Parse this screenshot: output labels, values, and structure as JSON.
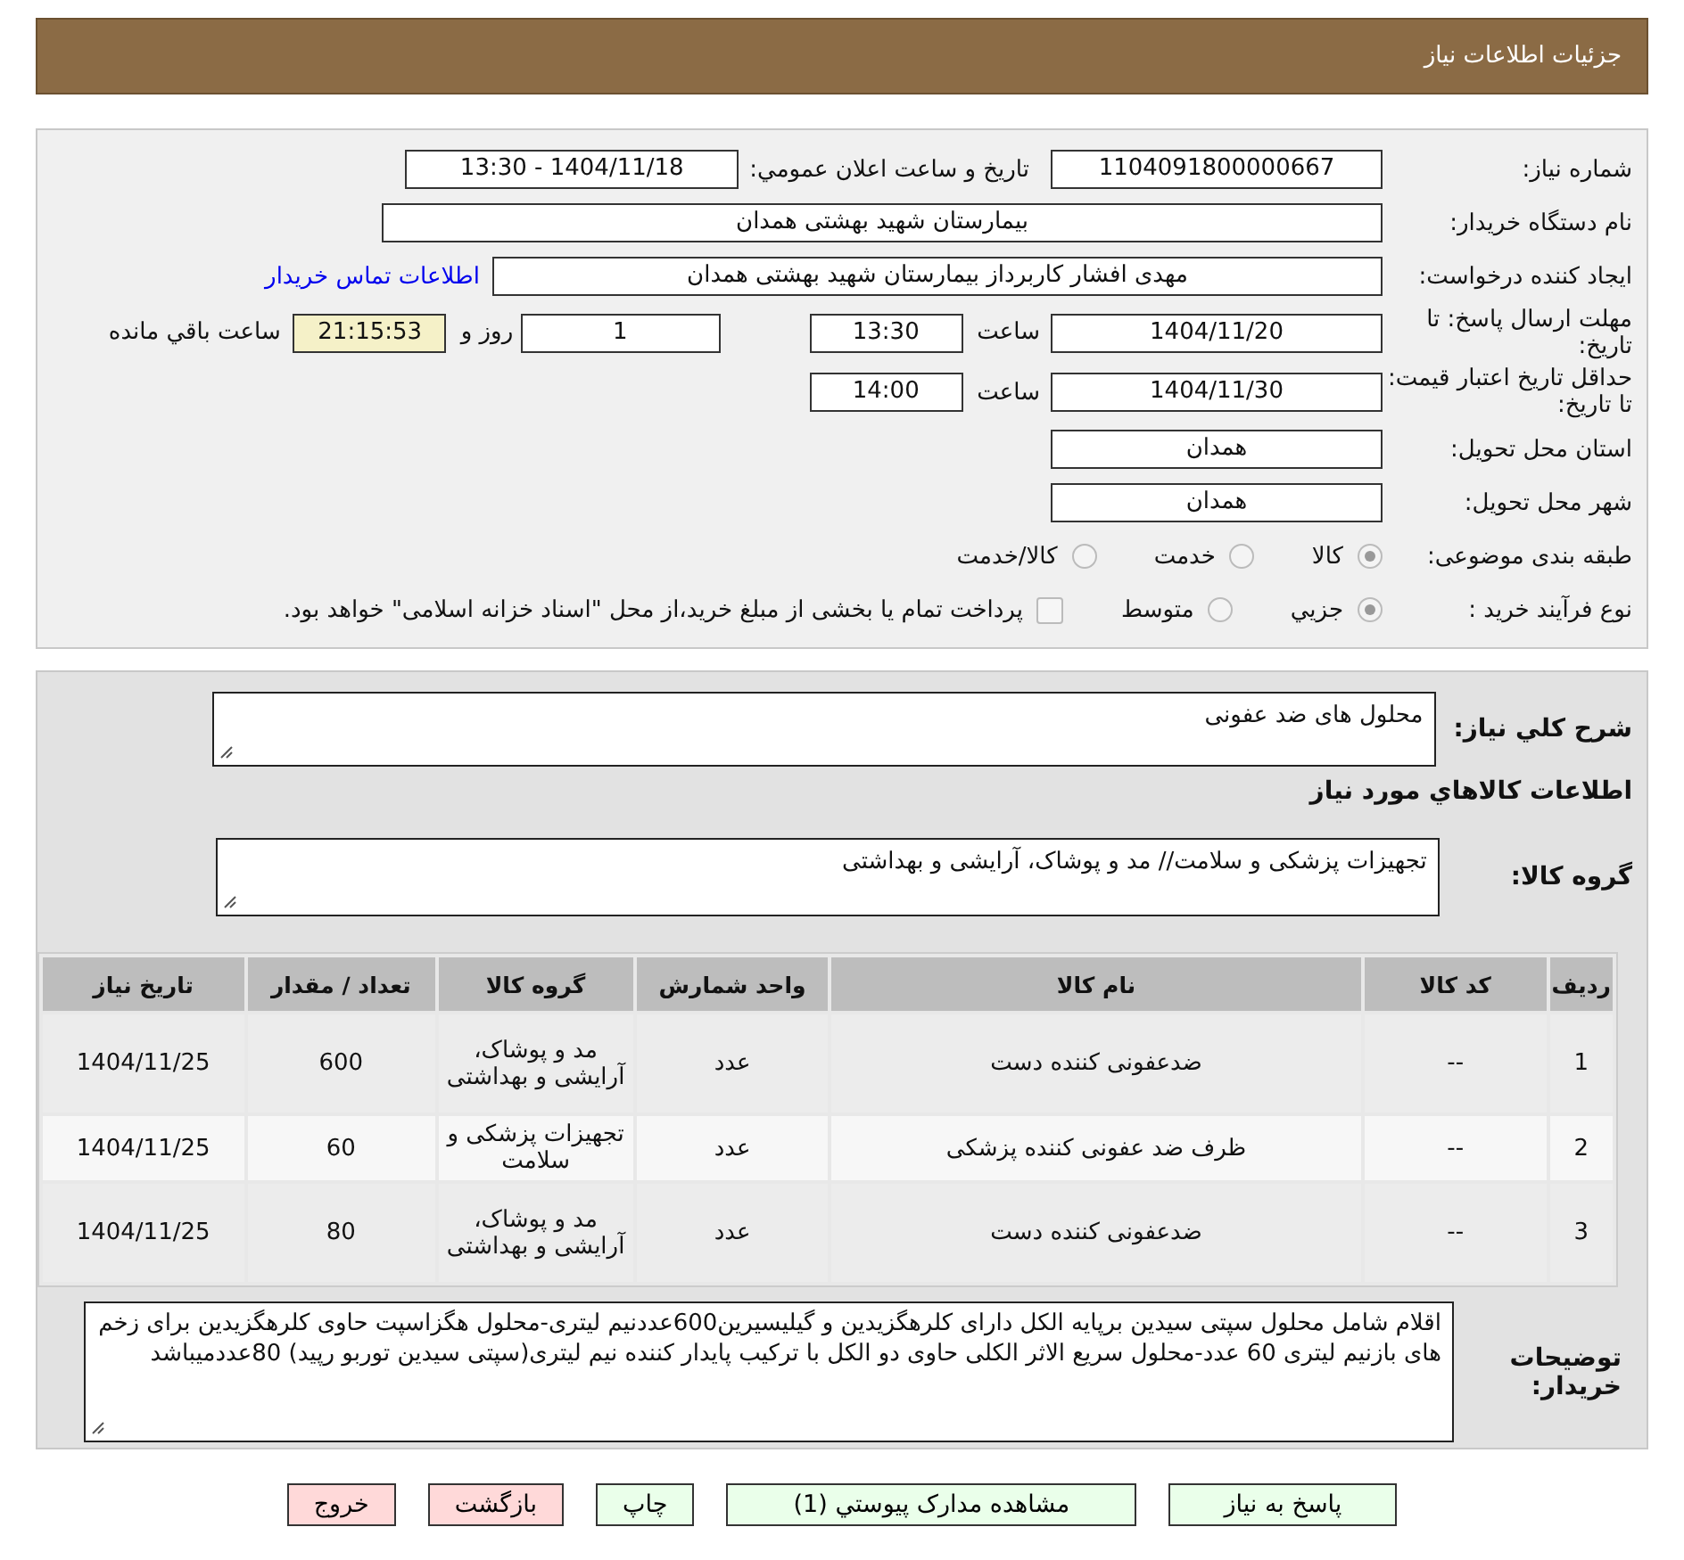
{
  "header": {
    "title": "جزئیات اطلاعات نیاز"
  },
  "form": {
    "need_number": {
      "label": "شماره نیاز:",
      "value": "1104091800000667"
    },
    "announce": {
      "label": "تاریخ و ساعت اعلان عمومي:",
      "value": "1404/11/18 - 13:30"
    },
    "buyer": {
      "label": "نام دستگاه خریدار:",
      "value": "بیمارستان شهید بهشتی همدان"
    },
    "requester": {
      "label": "ایجاد کننده درخواست:",
      "value": "مهدی افشار کاربرداز بیمارستان شهید بهشتی همدان",
      "link": "اطلاعات تماس خریدار"
    },
    "deadline": {
      "label": "مهلت ارسال پاسخ: تا تاریخ:",
      "date": "1404/11/20",
      "time_label": "ساعت",
      "time": "13:30",
      "days": "1",
      "days_label": "روز و",
      "remaining": "21:15:53",
      "remaining_label": "ساعت باقي مانده"
    },
    "validity": {
      "label": "حداقل تاریخ اعتبار قیمت: تا تاریخ:",
      "date": "1404/11/30",
      "time_label": "ساعت",
      "time": "14:00"
    },
    "province": {
      "label": "استان محل تحویل:",
      "value": "همدان"
    },
    "city": {
      "label": "شهر محل تحویل:",
      "value": "همدان"
    },
    "category": {
      "label": "طبقه بندی موضوعی:",
      "options": [
        {
          "label": "کالا",
          "selected": true
        },
        {
          "label": "خدمت",
          "selected": false
        },
        {
          "label": "کالا/خدمت",
          "selected": false
        }
      ]
    },
    "process": {
      "label": "نوع فرآیند خرید :",
      "options": [
        {
          "label": "جزيي",
          "selected": true
        },
        {
          "label": "متوسط",
          "selected": false
        }
      ],
      "checkbox": {
        "label": "پرداخت تمام یا بخشی از مبلغ خرید،از محل \"اسناد خزانه اسلامی\" خواهد بود.",
        "checked": false
      }
    }
  },
  "details": {
    "description": {
      "label": "شرح کلي نیاز:",
      "value": "محلول های ضد عفونی"
    },
    "goods_title": "اطلاعات کالاهاي مورد نیاز",
    "goods_group": {
      "label": "گروه کالا:",
      "value": "تجهیزات پزشکی و سلامت// مد و پوشاک، آرایشی و بهداشتی"
    },
    "table": {
      "columns": [
        "ردیف",
        "کد کالا",
        "نام کالا",
        "واحد شمارش",
        "گروه کالا",
        "تعداد / مقدار",
        "تاریخ نیاز"
      ],
      "rows": [
        [
          "1",
          "--",
          "ضدعفونی کننده دست",
          "عدد",
          "مد و پوشاک، آرایشی و بهداشتی",
          "600",
          "1404/11/25"
        ],
        [
          "2",
          "--",
          "ظرف ضد عفونی کننده پزشکی",
          "عدد",
          "تجهیزات پزشکی و سلامت",
          "60",
          "1404/11/25"
        ],
        [
          "3",
          "--",
          "ضدعفونی کننده دست",
          "عدد",
          "مد و پوشاک، آرایشی و بهداشتی",
          "80",
          "1404/11/25"
        ]
      ]
    },
    "notes": {
      "label": "توضیحات خریدار:",
      "value": "اقلام شامل محلول سپتی سیدین برپایه الکل دارای کلرهگزیدین و گیلیسیرین600عددنیم لیتری-محلول هگزاسپت حاوی کلرهگزیدین برای زخم های بازنیم لیتری 60 عدد-محلول سریع الاثر الکلی حاوی دو الکل با ترکیب پایدار کننده نیم لیتری(سپتی سیدین توربو رپید) 80عددمیباشد"
    }
  },
  "buttons": [
    {
      "label": "پاسخ به نیاز",
      "kind": "go"
    },
    {
      "label": "مشاهده مدارک پیوستي (1)",
      "kind": "go"
    },
    {
      "label": "چاپ",
      "kind": "go"
    },
    {
      "label": "بازگشت",
      "kind": "stop"
    },
    {
      "label": "خروج",
      "kind": "stop"
    }
  ]
}
